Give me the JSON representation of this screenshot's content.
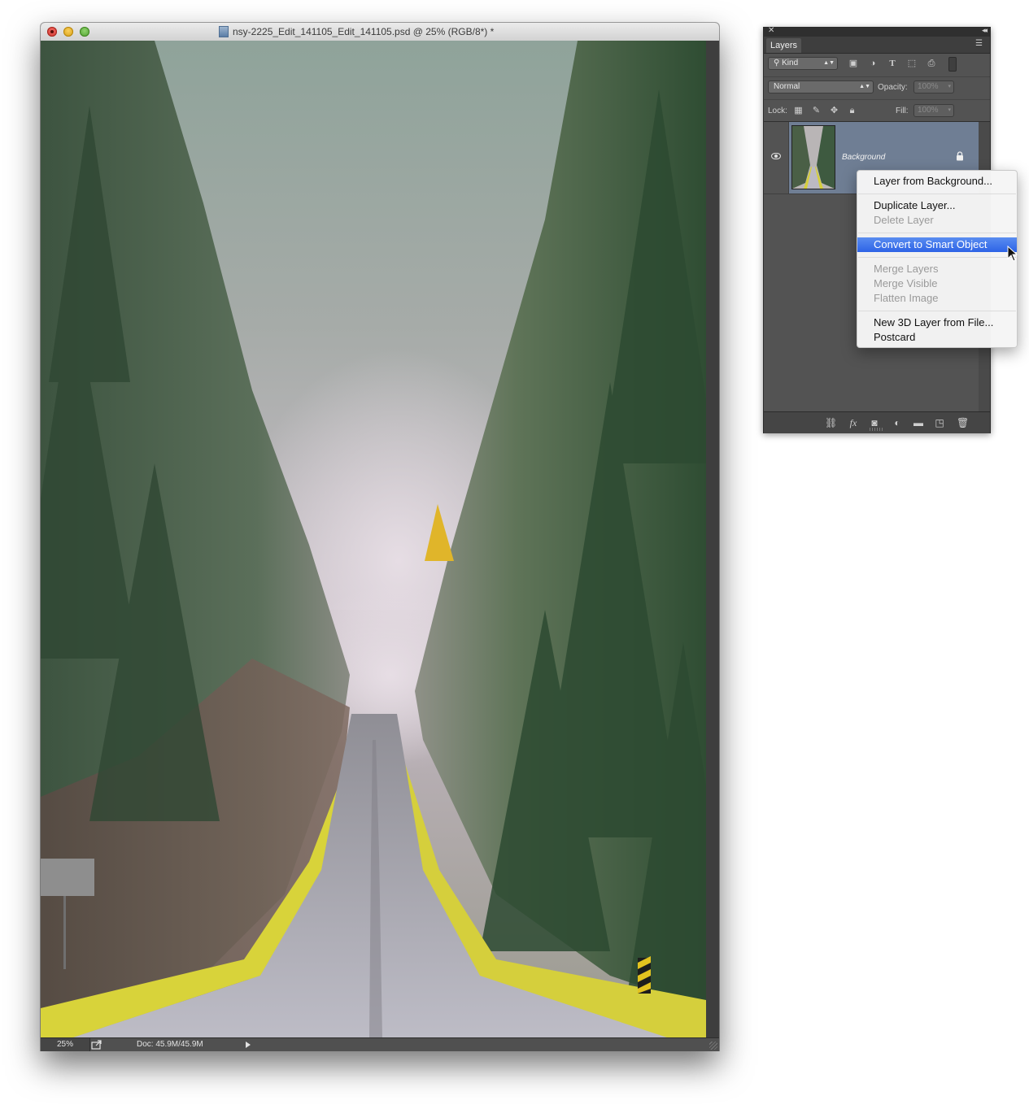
{
  "document": {
    "title": "nsy-2225_Edit_141105_Edit_141105.psd @ 25% (RGB/8*) *",
    "zoom": "25%",
    "doc_size": "Doc: 45.9M/45.9M"
  },
  "layers_panel": {
    "tab_label": "Layers",
    "filter_kind": "Kind",
    "blend_mode": "Normal",
    "opacity_label": "Opacity:",
    "opacity_value": "100%",
    "lock_label": "Lock:",
    "fill_label": "Fill:",
    "fill_value": "100%",
    "layers": [
      {
        "name": "Background",
        "visible": true,
        "locked": true,
        "selected": true
      }
    ],
    "footer_icons": [
      "link-icon",
      "fx-icon",
      "add-mask-icon",
      "adjustment-layer-icon",
      "new-group-icon",
      "new-layer-icon",
      "trash-icon"
    ]
  },
  "context_menu": {
    "items": [
      {
        "label": "Layer from Background...",
        "enabled": true
      },
      {
        "label": "Duplicate Layer...",
        "enabled": true
      },
      {
        "label": "Delete Layer",
        "enabled": false
      },
      {
        "label": "Convert to Smart Object",
        "enabled": true,
        "highlighted": true
      },
      {
        "label": "Merge Layers",
        "enabled": false
      },
      {
        "label": "Merge Visible",
        "enabled": false
      },
      {
        "label": "Flatten Image",
        "enabled": false
      },
      {
        "label": "New 3D Layer from File...",
        "enabled": true
      },
      {
        "label": "Postcard",
        "enabled": true
      }
    ]
  },
  "colors": {
    "menu_highlight": "#2d63e6",
    "selected_layer": "#6f7e94",
    "panel_bg": "#535353"
  }
}
